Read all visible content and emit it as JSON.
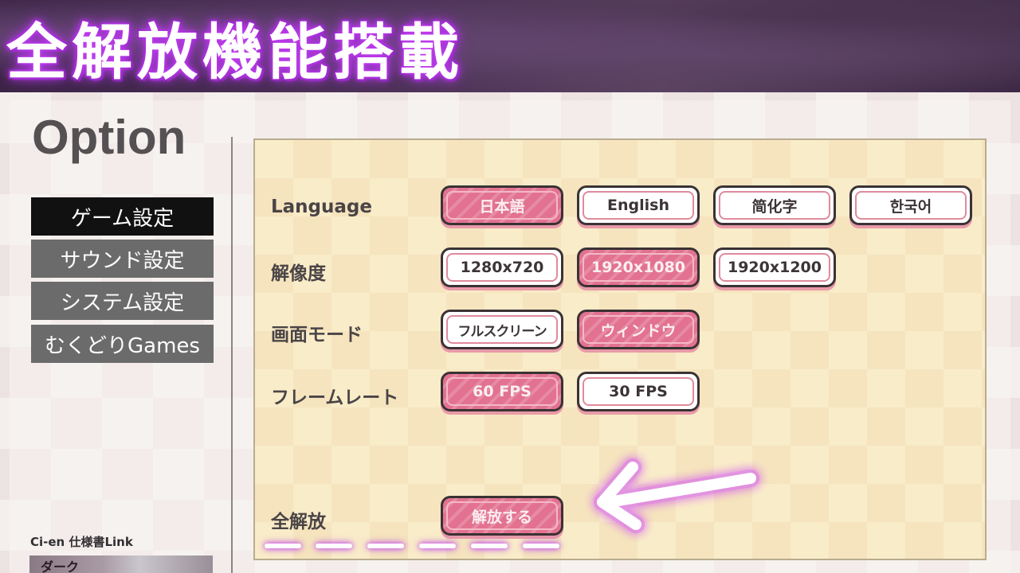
{
  "banner": {
    "title": "全解放機能搭載"
  },
  "page": {
    "title": "Option"
  },
  "menu": {
    "items": [
      {
        "label": "ゲーム設定",
        "active": true
      },
      {
        "label": "サウンド設定",
        "active": false
      },
      {
        "label": "システム設定",
        "active": false
      },
      {
        "label": "むくどりGames",
        "active": false
      }
    ]
  },
  "sidebar_footer": {
    "cien_label": "Ci-en 仕様書Link",
    "thumb_text": "ダーク"
  },
  "settings": {
    "language": {
      "label": "Language",
      "options": [
        "日本語",
        "English",
        "简化字",
        "한국어"
      ],
      "selected": "日本語"
    },
    "resolution": {
      "label": "解像度",
      "options": [
        "1280x720",
        "1920x1080",
        "1920x1200"
      ],
      "selected": "1920x1080"
    },
    "screen_mode": {
      "label": "画面モード",
      "options": [
        "フルスクリーン",
        "ウィンドウ"
      ],
      "selected": "ウィンドウ"
    },
    "frame_rate": {
      "label": "フレームレート",
      "options": [
        "60 FPS",
        "30 FPS"
      ],
      "selected": "60 FPS"
    },
    "unlock_all": {
      "label": "全解放",
      "button": "解放する"
    }
  },
  "colors": {
    "selected_button": "#e27290",
    "button_border": "#3a3234",
    "panel_bg": "#f9ecc9",
    "menu_active": "#111111",
    "menu_inactive": "#6b6b6b",
    "glow": "#c23ef0"
  },
  "icons": {
    "arrow": "left-arrow-icon"
  }
}
